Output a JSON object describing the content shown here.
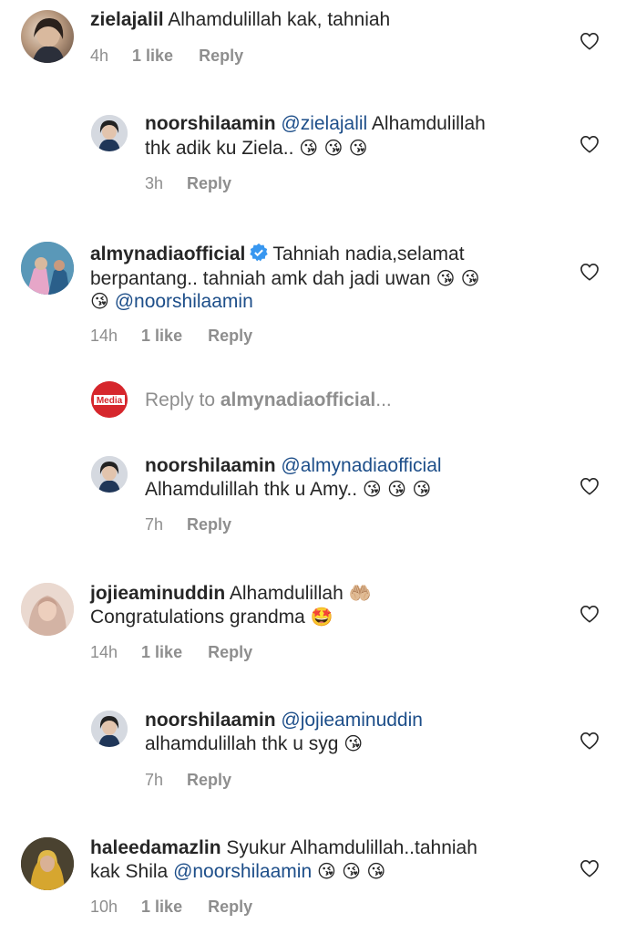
{
  "colors": {
    "mention": "#1d4e89",
    "muted": "#8e8e8e",
    "text": "#262626",
    "verified": "#3897f0"
  },
  "comments": [
    {
      "user": "zielajalil",
      "text": "Alhamdulillah kak, tahniah",
      "time": "4h",
      "likes": "1 like",
      "reply": "Reply"
    },
    {
      "user": "noorshilaamin",
      "mention": "@zielajalil",
      "text1": "Alhamdulillah",
      "text2": "thk adik ku Ziela..",
      "emoji": "😘 😘 😘",
      "time": "3h",
      "reply": "Reply"
    },
    {
      "user": "almynadiaofficial",
      "text1": "Tahniah nadia,selamat",
      "text2": "berpantang.. tahniah amk dah jadi uwan",
      "emoji1": "😘 😘",
      "emoji2": "😘",
      "mention": "@noorshilaamin",
      "time": "14h",
      "likes": "1 like",
      "reply": "Reply"
    },
    {
      "avatar_text": "Media",
      "prefix": "Reply to ",
      "target": "almynadiaofficial",
      "suffix": "..."
    },
    {
      "user": "noorshilaamin",
      "mention": "@almynadiaofficial",
      "text2": "Alhamdulillah thk u Amy..",
      "emoji": "😘 😘 😘",
      "time": "7h",
      "reply": "Reply"
    },
    {
      "user": "jojieaminuddin",
      "text1": "Alhamdulillah",
      "emoji1": "🤲🏼",
      "text2": "Congratulations grandma",
      "emoji2": "🤩",
      "time": "14h",
      "likes": "1 like",
      "reply": "Reply"
    },
    {
      "user": "noorshilaamin",
      "mention": "@jojieaminuddin",
      "text2": "alhamdulillah thk u syg",
      "emoji": "😘",
      "time": "7h",
      "reply": "Reply"
    },
    {
      "user": "haleedamazlin",
      "text1": "Syukur Alhamdulillah..tahniah",
      "text2": "kak Shila",
      "mention": "@noorshilaamin",
      "emoji": "😘 😘 😘",
      "time": "10h",
      "likes": "1 like",
      "reply": "Reply"
    }
  ]
}
